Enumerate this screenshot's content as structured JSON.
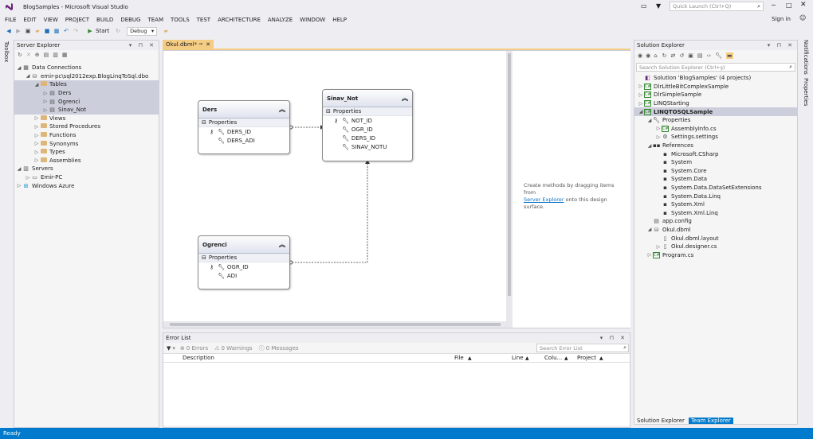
{
  "window": {
    "title": "BlogSamples - Microsoft Visual Studio",
    "quick_launch_placeholder": "Quick Launch (Ctrl+Q)",
    "sign_in": "Sign in"
  },
  "menu": [
    "FILE",
    "EDIT",
    "VIEW",
    "PROJECT",
    "BUILD",
    "DEBUG",
    "TEAM",
    "TOOLS",
    "TEST",
    "ARCHITECTURE",
    "ANALYZE",
    "WINDOW",
    "HELP"
  ],
  "toolbar": {
    "start_label": "Start",
    "config_value": "Debug"
  },
  "left_strip": {
    "toolbox": "Toolbox"
  },
  "right_strip": {
    "notifications": "Notifications",
    "properties": "Properties"
  },
  "server_explorer": {
    "title": "Server Explorer",
    "tree": [
      {
        "label": "Data Connections",
        "indent": 0,
        "tw": "◢",
        "icon": "db"
      },
      {
        "label": "emir-pc\\sql2012exp.BlogLinqToSql.dbo",
        "indent": 1,
        "tw": "◢",
        "icon": "conn"
      },
      {
        "label": "Tables",
        "indent": 2,
        "tw": "◢",
        "icon": "folder",
        "sel": true
      },
      {
        "label": "Ders",
        "indent": 3,
        "tw": "▷",
        "icon": "table",
        "sel": true
      },
      {
        "label": "Ogrenci",
        "indent": 3,
        "tw": "▷",
        "icon": "table",
        "sel": true
      },
      {
        "label": "Sinav_Not",
        "indent": 3,
        "tw": "▷",
        "icon": "table",
        "sel": true
      },
      {
        "label": "Views",
        "indent": 2,
        "tw": "▷",
        "icon": "folder"
      },
      {
        "label": "Stored Procedures",
        "indent": 2,
        "tw": "▷",
        "icon": "folder"
      },
      {
        "label": "Functions",
        "indent": 2,
        "tw": "▷",
        "icon": "folder"
      },
      {
        "label": "Synonyms",
        "indent": 2,
        "tw": "▷",
        "icon": "folder"
      },
      {
        "label": "Types",
        "indent": 2,
        "tw": "▷",
        "icon": "folder"
      },
      {
        "label": "Assemblies",
        "indent": 2,
        "tw": "▷",
        "icon": "folder"
      },
      {
        "label": "Servers",
        "indent": 0,
        "tw": "◢",
        "icon": "server"
      },
      {
        "label": "Emir-PC",
        "indent": 1,
        "tw": "▷",
        "icon": "pc"
      },
      {
        "label": "Windows Azure",
        "indent": 0,
        "tw": "▷",
        "icon": "azure"
      }
    ]
  },
  "editor": {
    "tab_label": "Okul.dbml*",
    "hint_text": "Create methods by dragging items from",
    "hint_link": "Server Explorer",
    "hint_tail": "onto this design surface.",
    "entities": {
      "ders": {
        "name": "Ders",
        "section": "Properties",
        "props": [
          "DERS_ID",
          "DERS_ADI"
        ]
      },
      "sinav": {
        "name": "Sinav_Not",
        "section": "Properties",
        "props": [
          "NOT_ID",
          "OGR_ID",
          "DERS_ID",
          "SINAV_NOTU"
        ]
      },
      "ogrenci": {
        "name": "Ogrenci",
        "section": "Properties",
        "props": [
          "OGR_ID",
          "ADI"
        ]
      }
    }
  },
  "error_list": {
    "title": "Error List",
    "errors": "0 Errors",
    "warnings": "0 Warnings",
    "messages": "0 Messages",
    "search_placeholder": "Search Error List",
    "columns": [
      "Description",
      "File",
      "Line",
      "Colu...",
      "Project"
    ]
  },
  "solution_explorer": {
    "title": "Solution Explorer",
    "search_placeholder": "Search Solution Explorer (Ctrl+ş)",
    "tree": [
      {
        "label": "Solution 'BlogSamples' (4 projects)",
        "indent": 0,
        "tw": "",
        "icon": "sln"
      },
      {
        "label": "DlrLittleBitComplexSample",
        "indent": 0,
        "tw": "▷",
        "icon": "proj"
      },
      {
        "label": "DlrSimpleSample",
        "indent": 0,
        "tw": "▷",
        "icon": "proj"
      },
      {
        "label": "LINQStarting",
        "indent": 0,
        "tw": "▷",
        "icon": "proj"
      },
      {
        "label": "LINQTOSQLSample",
        "indent": 0,
        "tw": "◢",
        "icon": "proj",
        "sel": true,
        "bold": true
      },
      {
        "label": "Properties",
        "indent": 1,
        "tw": "◢",
        "icon": "wrench"
      },
      {
        "label": "AssemblyInfo.cs",
        "indent": 2,
        "tw": "▷",
        "icon": "cs"
      },
      {
        "label": "Settings.settings",
        "indent": 2,
        "tw": "▷",
        "icon": "gear"
      },
      {
        "label": "References",
        "indent": 1,
        "tw": "◢",
        "icon": "ref"
      },
      {
        "label": "Microsoft.CSharp",
        "indent": 2,
        "tw": "",
        "icon": "asm"
      },
      {
        "label": "System",
        "indent": 2,
        "tw": "",
        "icon": "asm"
      },
      {
        "label": "System.Core",
        "indent": 2,
        "tw": "",
        "icon": "asm"
      },
      {
        "label": "System.Data",
        "indent": 2,
        "tw": "",
        "icon": "asm"
      },
      {
        "label": "System.Data.DataSetExtensions",
        "indent": 2,
        "tw": "",
        "icon": "asm"
      },
      {
        "label": "System.Data.Linq",
        "indent": 2,
        "tw": "",
        "icon": "asm"
      },
      {
        "label": "System.Xml",
        "indent": 2,
        "tw": "",
        "icon": "asm"
      },
      {
        "label": "System.Xml.Linq",
        "indent": 2,
        "tw": "",
        "icon": "asm"
      },
      {
        "label": "app.config",
        "indent": 1,
        "tw": "",
        "icon": "cfg"
      },
      {
        "label": "Okul.dbml",
        "indent": 1,
        "tw": "◢",
        "icon": "dbml"
      },
      {
        "label": "Okul.dbml.layout",
        "indent": 2,
        "tw": "",
        "icon": "file"
      },
      {
        "label": "Okul.designer.cs",
        "indent": 2,
        "tw": "▷",
        "icon": "file"
      },
      {
        "label": "Program.cs",
        "indent": 1,
        "tw": "▷",
        "icon": "cs"
      }
    ],
    "bottom_tabs": [
      "Solution Explorer",
      "Team Explorer"
    ]
  },
  "status": {
    "text": "Ready"
  },
  "colors": {
    "accent": "#007acc",
    "tab_active": "#f5cc84",
    "selection": "#cccedb",
    "vs_purple": "#68217a"
  }
}
